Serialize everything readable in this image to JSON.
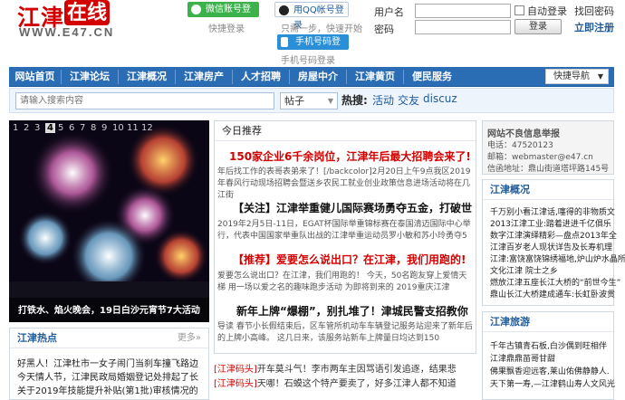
{
  "header": {
    "logo_cn": "江津",
    "logo_box": "在线",
    "logo_url": "WWW.E47.CN",
    "wechat_login": "微信账号登录",
    "wechat_sub": "快捷登录",
    "qq_login": "用QQ帐号登录",
    "qq_sub": "只需一步，快速开始",
    "phone_login": "手机号码登录",
    "phone_sub": "手机号码登录",
    "username_label": "用户名",
    "password_label": "密码",
    "autologin_label": "自动登录",
    "forgot_password": "找回密码",
    "login_button": "登录",
    "register": "立即注册"
  },
  "nav": {
    "items": [
      "网站首页",
      "江津论坛",
      "江津概况",
      "江津房产",
      "人才招聘",
      "房屋中介",
      "江津黄页",
      "便民服务"
    ],
    "quick_nav": "快捷导航"
  },
  "search": {
    "placeholder": "请输入搜索内容",
    "scope": "帖子",
    "hot_label": "热搜:",
    "hot_terms": [
      "活动",
      "交友",
      "discuz"
    ]
  },
  "slideshow": {
    "pages": [
      "1",
      "2",
      "3",
      "4",
      "5",
      "6",
      "7",
      "8",
      "9",
      "10",
      "11",
      "12"
    ],
    "active_page": "4",
    "caption": "打铁水、焰火晚会，19日白沙元宵节7大活动"
  },
  "jiangjin_hot": {
    "title": "江津热点",
    "more": "更多»",
    "items": [
      "好黑人！江津杜市一女子闹门当刹车撞飞路边",
      "今天情人节，江津民政局婚姻登记处排起了长",
      "关于2019年技能提升补贴(第1批)审核情况的"
    ]
  },
  "today": {
    "title": "今日推荐",
    "blocks": [
      {
        "head": "150家企业6千余岗位，江津年后最大招聘会来了!",
        "body": "年后找工作的表哥表弟来了！[/backcolor]2月20日上午9点我区2019年春风行动现场招聘会暨送乡农民工就业创业政策信息进场活动将在几江街"
      },
      {
        "head": "【关注】江津举重健儿国际赛场勇夺五金，打破世",
        "body": "2019年2月5日-11日，EGAT杯国际举重锦标赛在泰国清迈国际中心举行，代表中国国家举重队出战的江津举重运动员罗小敏和苏小玲勇夺5"
      },
      {
        "head": "【推荐】爱要怎么说出口？在江津，我们用跑的!",
        "body": "爱要怎么说出口？在江津，我们用跑的！ 今天，50名跑友穿上爱情天梯 用一场以爱之名的趣味跑步活动 为即将到来的 2019重庆江津"
      },
      {
        "head": "新年上牌“爆棚”，别扎堆了！津城民警支招教你",
        "body": "导读 春节小长假结束后，区车管所机动车车辆登记服务站迎来了新年后的上牌小高峰。 这几日来，该服务站新车上牌量日均达到150"
      }
    ],
    "bottom": [
      {
        "tag": "[江津码头]",
        "text": "开车莫斗气！李市两车主因骂语引发追逐，结果悲"
      },
      {
        "tag": "[江津码头]",
        "text": "天哪！石蟆这个特产要卖了，好多江津人都不知道"
      }
    ]
  },
  "report": {
    "title": "网站不良信息举报",
    "phone": "电话：47520123",
    "email": "邮箱：webmaster@e47.cn",
    "address": "信函地址：鼎山街道塔坪路145号"
  },
  "overview": {
    "title": "江津概况",
    "items": [
      "千万别小看江津话,噻得的非物质文",
      "2013江津工业:踏着进进千亿俱乐",
      "数字江津演绎精彩—盘点2013年全",
      "江津百岁老人现状详告及长寿机理",
      "江津:富饶富饶锦绣福地,炉山炉水晶所",
      "文化江津 院士之乡",
      "燃放江津五座长江大桥的“前世今生”",
      "鼎山长江大桥建成通车:长虹卧波贯"
    ]
  },
  "travel": {
    "title": "江津旅游",
    "items": [
      "千年古镇青石板,白沙偶到旺相伴",
      "江津鼎鼎苗哥甘甜",
      "佛果飘香迎远客,莱山佑佛静静人.",
      "天下第一寿,—江津鹤山寿人文风光"
    ]
  }
}
